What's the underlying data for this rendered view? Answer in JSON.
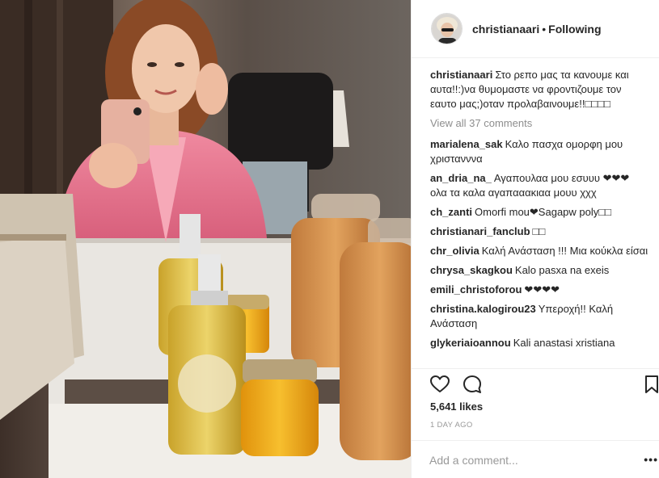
{
  "post": {
    "username": "christianaari",
    "separator": "•",
    "follow_status": "Following",
    "caption": {
      "username": "christianaari",
      "text": "Στο ρεπο μας τα κανουμε και αυτα!!:)να θυμομαστε να φροντιζουμε τον εαυτο μας;)οταν προλαβαινουμε!!□□□□"
    },
    "view_all_comments": "View all 37 comments",
    "comments": [
      {
        "user": "marialena_sak",
        "text": "Καλο πασχα ομορφη μου χριστανννα"
      },
      {
        "user": "an_dria_na_",
        "text": "Αγαπουλαα μου εσυυυ ❤❤❤ ολα τα καλα αγαπααακιαα μουυ χχχ"
      },
      {
        "user": "ch_zanti",
        "text": "Omorfi mou❤Sagapw poly□□"
      },
      {
        "user": "christianari_fanclub",
        "text": "□□"
      },
      {
        "user": "chr_olivia",
        "text": "Καλή Ανάσταση !!! Μια κούκλα είσαι"
      },
      {
        "user": "chrysa_skagkou",
        "text": "Kalo pasxa na exeis"
      },
      {
        "user": "emili_christoforou",
        "text": "❤❤❤❤"
      },
      {
        "user": "christina.kalogirou23",
        "text": "Υπεροχή!! Καλή Ανάσταση"
      },
      {
        "user": "glykeriaioannou",
        "text": "Kali anastasi xristiana"
      }
    ],
    "likes": "5,641 likes",
    "timestamp": "1 DAY AGO",
    "add_comment_placeholder": "Add a comment...",
    "more_label": "•••"
  },
  "icons": {
    "like": "heart-icon",
    "comment": "speech-bubble-icon",
    "save": "bookmark-icon"
  },
  "colors": {
    "text": "#262626",
    "muted": "#8e8e8e",
    "border": "#efefef"
  }
}
